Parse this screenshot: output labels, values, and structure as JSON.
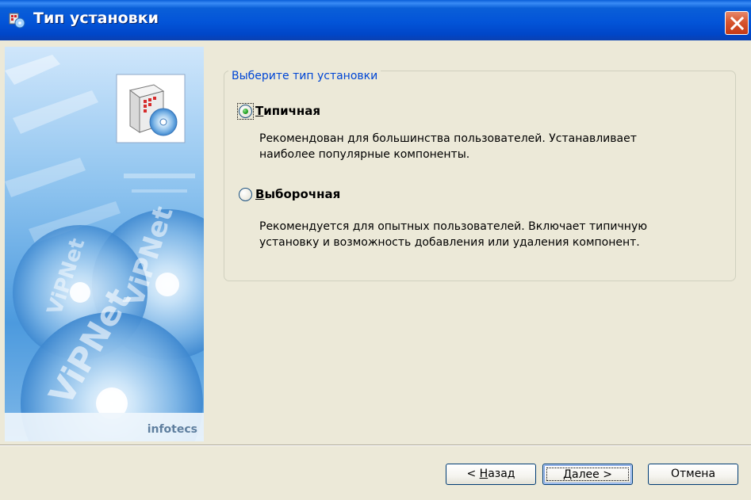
{
  "window": {
    "title": "Тип установки",
    "close_icon": "close-icon",
    "app_icon": "setup-icon"
  },
  "banner": {
    "brand_text": "infotecs",
    "product_text": "ViPNet",
    "product_icon": "package-disc-icon"
  },
  "install_type": {
    "group_title": "Выберите тип установки",
    "options": [
      {
        "label_accel": "Т",
        "label_rest": "ипичная",
        "selected": true,
        "description_line1": "Рекомендован для большинства пользователей. Устанавливает",
        "description_line2": "наиболее популярные компоненты."
      },
      {
        "label_accel": "В",
        "label_rest": "ыборочная",
        "selected": false,
        "description_line1": "Рекомендуется для опытных пользователей. Включает типичную",
        "description_line2": "установку и возможность добавления или удаления компонент."
      }
    ]
  },
  "buttons": {
    "back_prefix": "< ",
    "back_accel": "Н",
    "back_rest": "азад",
    "next_accel": "Д",
    "next_rest": "алее >",
    "cancel": "Отмена"
  },
  "colors": {
    "titlebar": "#0354d8",
    "group_title": "#0046d5",
    "dialog_bg": "#ece9d8",
    "close_button": "#d7552f"
  }
}
